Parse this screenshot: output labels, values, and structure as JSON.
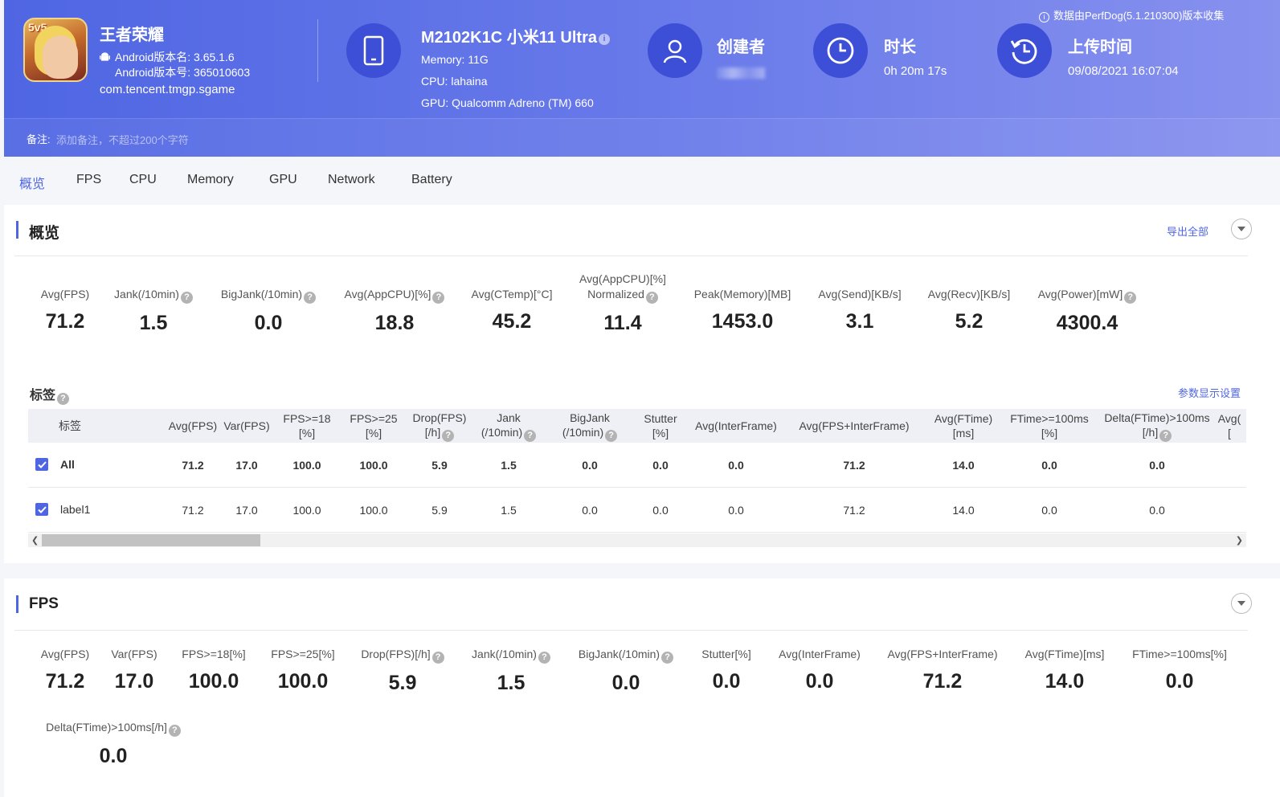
{
  "header": {
    "app": {
      "icon_text": "5v5",
      "name": "王者荣耀",
      "version_name": "Android版本名: 3.65.1.6",
      "version_code": "Android版本号: 365010603",
      "package": "com.tencent.tmgp.sgame"
    },
    "device": {
      "icon": "phone-icon",
      "title": "M2102K1C 小米11 Ultra",
      "memory": "Memory: 11G",
      "cpu": "CPU: lahaina",
      "gpu": "GPU: Qualcomm Adreno (TM) 660"
    },
    "creator": {
      "icon": "user-icon",
      "label": "创建者"
    },
    "duration": {
      "icon": "clock-icon",
      "label": "时长",
      "value": "0h 20m 17s"
    },
    "upload": {
      "icon": "history-icon",
      "label": "上传时间",
      "value": "09/08/2021 16:07:04"
    },
    "source_note": "数据由PerfDog(5.1.210300)版本收集",
    "note_label": "备注:",
    "note_placeholder": "添加备注，不超过200个字符"
  },
  "tabs": [
    "概览",
    "FPS",
    "CPU",
    "Memory",
    "GPU",
    "Network",
    "Battery"
  ],
  "overview": {
    "title": "概览",
    "export_label": "导出全部",
    "stats": [
      {
        "label": "Avg(FPS)",
        "value": "71.2",
        "help": false
      },
      {
        "label": "Jank(/10min)",
        "value": "1.5",
        "help": true
      },
      {
        "label": "BigJank(/10min)",
        "value": "0.0",
        "help": true
      },
      {
        "label": "Avg(AppCPU)[%]",
        "value": "18.8",
        "help": true
      },
      {
        "label": "Avg(CTemp)[°C]",
        "value": "45.2",
        "help": false
      },
      {
        "label": "Avg(AppCPU)[%]",
        "label2": "Normalized",
        "value": "11.4",
        "help": true
      },
      {
        "label": "Peak(Memory)[MB]",
        "value": "1453.0",
        "help": false
      },
      {
        "label": "Avg(Send)[KB/s]",
        "value": "3.1",
        "help": false
      },
      {
        "label": "Avg(Recv)[KB/s]",
        "value": "5.2",
        "help": false
      },
      {
        "label": "Avg(Power)[mW]",
        "value": "4300.4",
        "help": true
      }
    ],
    "tags_title": "标签",
    "display_settings": "参数显示设置",
    "table": {
      "columns": [
        {
          "l1": "标签",
          "l2": "",
          "help": false
        },
        {
          "l1": "Avg(FPS)",
          "l2": "",
          "help": false
        },
        {
          "l1": "Var(FPS)",
          "l2": "",
          "help": false
        },
        {
          "l1": "FPS>=18",
          "l2": "[%]",
          "help": false
        },
        {
          "l1": "FPS>=25",
          "l2": "[%]",
          "help": false
        },
        {
          "l1": "Drop(FPS)",
          "l2": "[/h]",
          "help": true
        },
        {
          "l1": "Jank",
          "l2": "(/10min)",
          "help": true
        },
        {
          "l1": "BigJank",
          "l2": "(/10min)",
          "help": true
        },
        {
          "l1": "Stutter",
          "l2": "[%]",
          "help": false
        },
        {
          "l1": "Avg(InterFrame)",
          "l2": "",
          "help": false
        },
        {
          "l1": "Avg(FPS+InterFrame)",
          "l2": "",
          "help": false
        },
        {
          "l1": "Avg(FTime)",
          "l2": "[ms]",
          "help": false
        },
        {
          "l1": "FTime>=100ms",
          "l2": "[%]",
          "help": false
        },
        {
          "l1": "Delta(FTime)>100ms",
          "l2": "[/h]",
          "help": true
        },
        {
          "l1": "Avg(",
          "l2": "[",
          "help": false
        }
      ],
      "rows": [
        {
          "name": "All",
          "bold": true,
          "checked": true,
          "cells": [
            "71.2",
            "17.0",
            "100.0",
            "100.0",
            "5.9",
            "1.5",
            "0.0",
            "0.0",
            "0.0",
            "71.2",
            "14.0",
            "0.0",
            "0.0"
          ]
        },
        {
          "name": "label1",
          "bold": false,
          "checked": true,
          "cells": [
            "71.2",
            "17.0",
            "100.0",
            "100.0",
            "5.9",
            "1.5",
            "0.0",
            "0.0",
            "0.0",
            "71.2",
            "14.0",
            "0.0",
            "0.0"
          ]
        }
      ]
    }
  },
  "fps": {
    "title": "FPS",
    "stats": [
      {
        "label": "Avg(FPS)",
        "value": "71.2",
        "help": false
      },
      {
        "label": "Var(FPS)",
        "value": "17.0",
        "help": false
      },
      {
        "label": "FPS>=18[%]",
        "value": "100.0",
        "help": false
      },
      {
        "label": "FPS>=25[%]",
        "value": "100.0",
        "help": false
      },
      {
        "label": "Drop(FPS)[/h]",
        "value": "5.9",
        "help": true
      },
      {
        "label": "Jank(/10min)",
        "value": "1.5",
        "help": true
      },
      {
        "label": "BigJank(/10min)",
        "value": "0.0",
        "help": true
      },
      {
        "label": "Stutter[%]",
        "value": "0.0",
        "help": false
      },
      {
        "label": "Avg(InterFrame)",
        "value": "0.0",
        "help": false
      },
      {
        "label": "Avg(FPS+InterFrame)",
        "value": "71.2",
        "help": false
      },
      {
        "label": "Avg(FTime)[ms]",
        "value": "14.0",
        "help": false
      },
      {
        "label": "FTime>=100ms[%]",
        "value": "0.0",
        "help": false
      },
      {
        "label": "Delta(FTime)>100ms[/h]",
        "value": "0.0",
        "help": true
      }
    ]
  },
  "colors": {
    "accent": "#4f66e3",
    "header_start": "#4f66e3",
    "header_end": "#8791ee",
    "icon_circle": "#3d4fd6"
  }
}
